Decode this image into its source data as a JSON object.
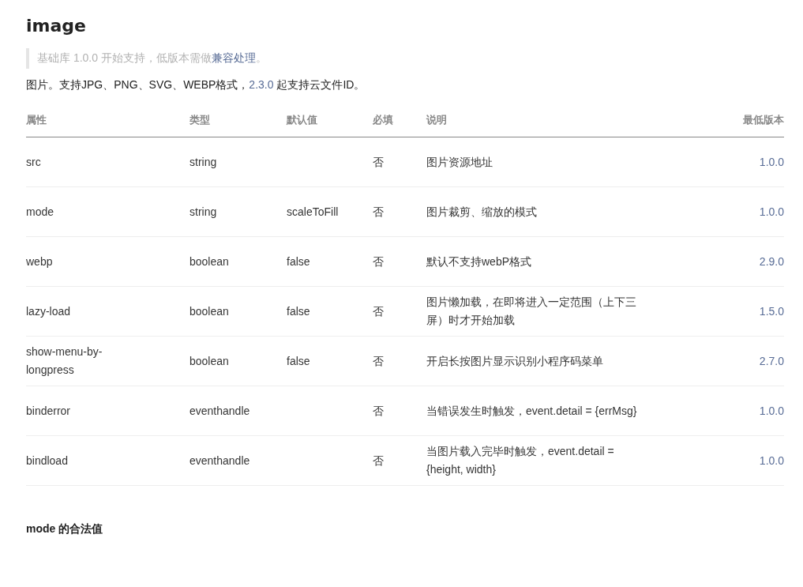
{
  "title": "image",
  "note": {
    "text": "基础库 1.0.0 开始支持，低版本需做",
    "link": "兼容处理",
    "after": "。"
  },
  "intro": {
    "before": "图片。支持JPG、PNG、SVG、WEBP格式，",
    "link": "2.3.0",
    "after": " 起支持云文件ID。"
  },
  "table": {
    "columns": [
      "属性",
      "类型",
      "默认值",
      "必填",
      "说明",
      "最低版本"
    ],
    "rows": [
      {
        "cells": [
          "src",
          "string",
          "",
          "否",
          "图片资源地址",
          "1.0.0"
        ]
      },
      {
        "cells": [
          "mode",
          "string",
          "scaleToFill",
          "否",
          "图片裁剪、缩放的模式",
          "1.0.0"
        ]
      },
      {
        "cells": [
          "webp",
          "boolean",
          "false",
          "否",
          "默认不支持webP格式",
          "2.9.0"
        ]
      },
      {
        "cells": [
          "lazy-load",
          "boolean",
          "false",
          "否",
          "图片懒加载，在即将进入一定范围（上下三屏）时才开始加载",
          "1.5.0"
        ]
      },
      {
        "cells": [
          "show-menu-by-longpress",
          "boolean",
          "false",
          "否",
          "开启长按图片显示识别小程序码菜单",
          "2.7.0"
        ]
      },
      {
        "cells": [
          "binderror",
          "eventhandle",
          "",
          "否",
          "当错误发生时触发，event.detail = {errMsg}",
          "1.0.0"
        ]
      },
      {
        "cells": [
          "bindload",
          "eventhandle",
          "",
          "否",
          "当图片载入完毕时触发，event.detail = {height, width}",
          "1.0.0"
        ]
      }
    ]
  },
  "subheading": "mode 的合法值"
}
